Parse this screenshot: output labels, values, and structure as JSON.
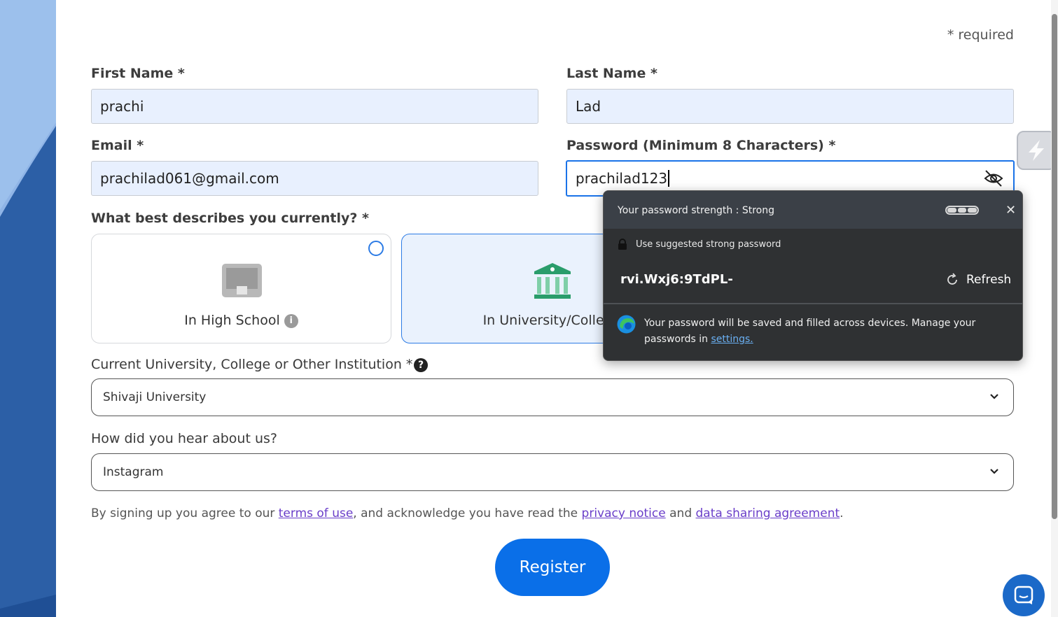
{
  "form": {
    "required_note": "* required",
    "first_name": {
      "label": "First Name *",
      "value": "prachi"
    },
    "last_name": {
      "label": "Last Name *",
      "value": "Lad"
    },
    "email": {
      "label": "Email *",
      "value": "prachilad061@gmail.com"
    },
    "password": {
      "label": "Password (Minimum 8 Characters) *",
      "value": "prachilad123"
    },
    "describe_question": "What best describes you currently? *",
    "options": [
      {
        "label": "In High School",
        "selected": false
      },
      {
        "label": "In University/College",
        "selected": true
      }
    ],
    "institution": {
      "label": "Current University, College or Other Institution *",
      "value": "Shivaji University"
    },
    "hear_about": {
      "label": "How did you hear about us?",
      "value": "Instagram"
    },
    "agreement": {
      "prefix": "By signing up you agree to our ",
      "terms_link": "terms of use",
      "middle": ", and acknowledge you have read the ",
      "privacy_link": "privacy notice",
      "and_text": " and ",
      "data_link": "data sharing agreement",
      "suffix": "."
    },
    "register_label": "Register"
  },
  "password_popup": {
    "strength_text": "Your password strength :  Strong",
    "suggest_label": "Use suggested strong password",
    "suggested_password": "rvi.Wxj6:9TdPL-",
    "refresh_label": "Refresh",
    "footer_text": "Your password will be saved and filled across devices. Manage your passwords in ",
    "settings_link": "settings."
  },
  "colors": {
    "accent": "#0a6fe8",
    "input_bg": "#e8f0fe",
    "popup_bg": "#2f3133",
    "link": "#6a3ec9"
  }
}
